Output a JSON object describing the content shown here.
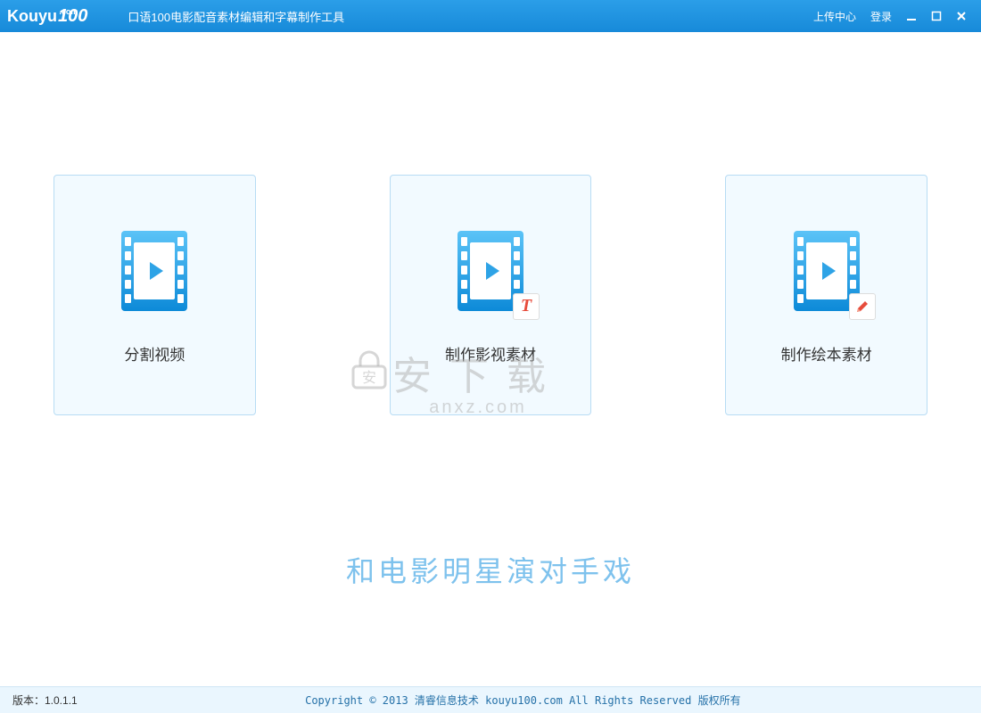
{
  "header": {
    "logo_text": "Kouyu",
    "logo_num": "100",
    "logo_com": ".com",
    "app_title": "口语100电影配音素材编辑和字幕制作工具",
    "upload_link": "上传中心",
    "login_link": "登录"
  },
  "cards": [
    {
      "label": "分割视频",
      "overlay": "none"
    },
    {
      "label": "制作影视素材",
      "overlay": "text"
    },
    {
      "label": "制作绘本素材",
      "overlay": "pencil"
    }
  ],
  "tagline": "和电影明星演对手戏",
  "footer": {
    "version_label": "版本：1.0.1.1",
    "copyright": "Copyright © 2013 清睿信息技术 kouyu100.com All Rights Reserved 版权所有"
  },
  "watermark": {
    "cn": "安下载",
    "en": "anxz.com"
  },
  "colors": {
    "accent": "#178ad9",
    "card_border": "#b8dcf4",
    "card_bg": "#f2faff",
    "tagline": "#7ec2ed"
  }
}
